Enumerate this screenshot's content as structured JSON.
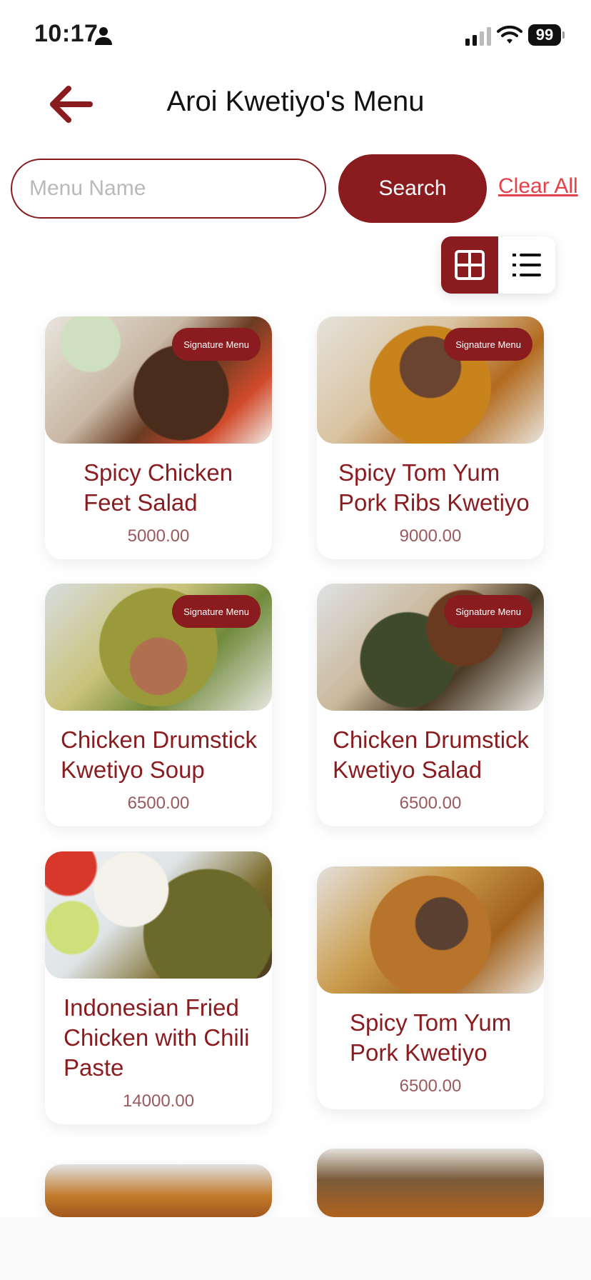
{
  "status_bar": {
    "time": "10:17",
    "battery": "99"
  },
  "header": {
    "title": "Aroi Kwetiyo's Menu"
  },
  "search": {
    "placeholder": "Menu Name",
    "value": "",
    "button_label": "Search",
    "clear_label": "Clear All"
  },
  "view_toggle": {
    "active": "grid"
  },
  "colors": {
    "accent": "#8a1c1f",
    "clear_link": "#e2434a",
    "price": "#9a5a5d"
  },
  "menu": [
    {
      "name": "Spicy Chicken Feet Salad",
      "price": "5000.00",
      "badge": "Signature Menu"
    },
    {
      "name": "Spicy Tom Yum Pork Ribs Kwetiyo",
      "price": "9000.00",
      "badge": "Signature Menu"
    },
    {
      "name": "Chicken Drumstick Kwetiyo Soup",
      "price": "6500.00",
      "badge": "Signature Menu"
    },
    {
      "name": "Chicken Drumstick Kwetiyo Salad",
      "price": "6500.00",
      "badge": "Signature Menu"
    },
    {
      "name": "Indonesian Fried Chicken with Chili Paste",
      "price": "14000.00",
      "badge": ""
    },
    {
      "name": "Spicy Tom Yum Pork Kwetiyo",
      "price": "6500.00",
      "badge": ""
    }
  ]
}
